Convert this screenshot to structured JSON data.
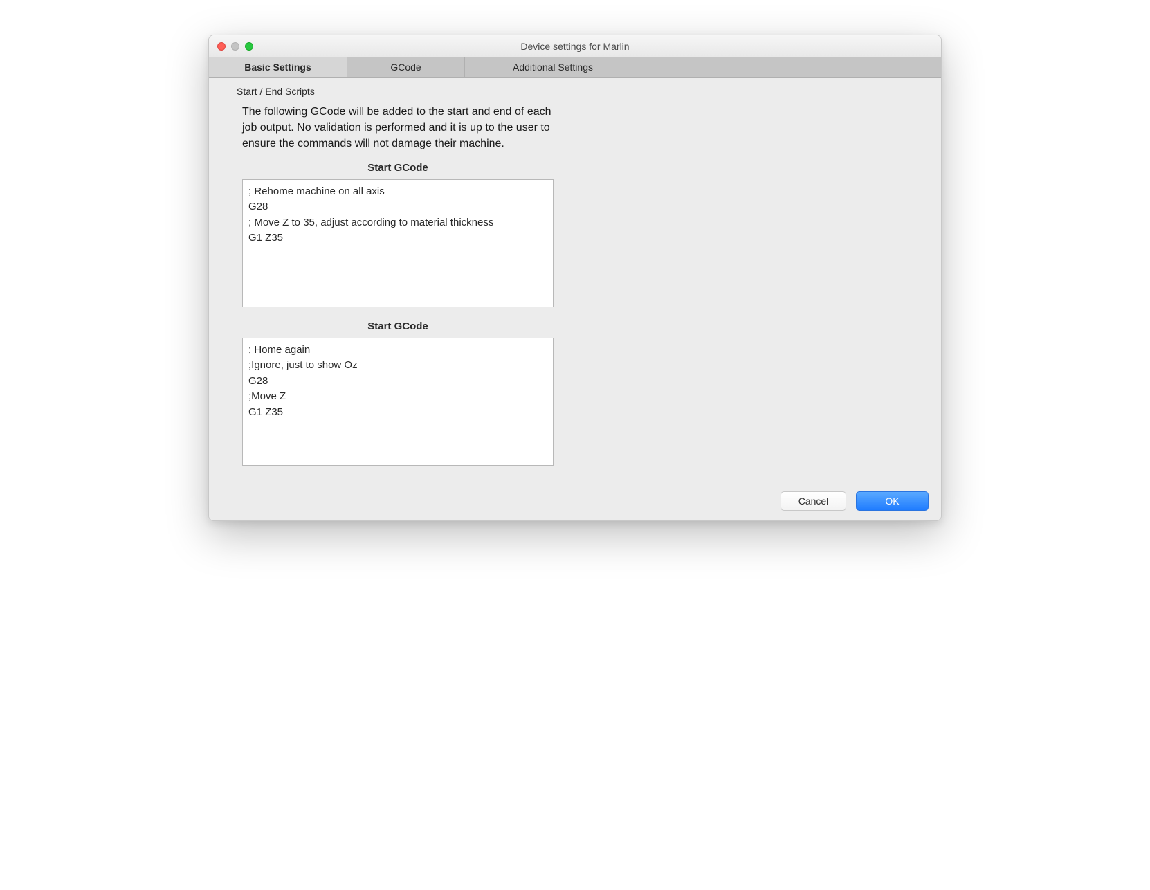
{
  "window": {
    "title": "Device settings for Marlin"
  },
  "tabs": {
    "basic": "Basic Settings",
    "gcode": "GCode",
    "additional": "Additional Settings"
  },
  "section": {
    "label": "Start / End Scripts",
    "description": "The following GCode will be added to the start and end of each job output. No validation is performed and it is up to the user to ensure the commands will not damage their machine."
  },
  "block1": {
    "title": "Start GCode",
    "content": "; Rehome machine on all axis\nG28\n; Move Z to 35, adjust according to material thickness\nG1 Z35"
  },
  "block2": {
    "title": "Start GCode",
    "content": "; Home again\n;Ignore, just to show Oz\nG28\n;Move Z\nG1 Z35"
  },
  "buttons": {
    "cancel": "Cancel",
    "ok": "OK"
  }
}
